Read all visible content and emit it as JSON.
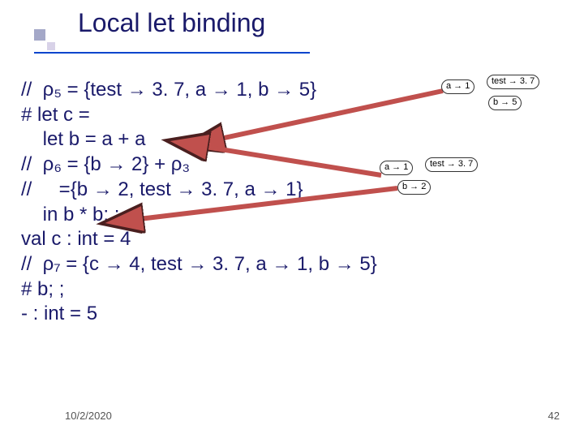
{
  "title": "Local let binding",
  "footer": {
    "date": "10/2/2020",
    "page": "42"
  },
  "lines": {
    "l1": "//  ρ₅ = {test → 3. 7, a → 1, b → 5}",
    "l2": "# let c =",
    "l3": "    let b = a + a",
    "l4": "//  ρ₆ = {b → 2} + ρ₃",
    "l5": "//     ={b → 2, test → 3. 7, a → 1}",
    "l6": "    in b * b; ;",
    "l7": "val c : int = 4",
    "l8": "//  ρ₇ = {c → 4, test → 3. 7, a → 1, b → 5}",
    "l9": "# b; ;",
    "l10": "- : int = 5"
  },
  "clouds": {
    "c1a": "a → 1",
    "c1b": "test → 3. 7",
    "c1c": "b → 5",
    "c2a": "a → 1",
    "c2b": "test → 3. 7",
    "c2c": "b → 2"
  },
  "colors": {
    "text": "#1a1a6a",
    "arrowFill": "#c0504d",
    "arrowStroke": "#4a1f1f"
  }
}
